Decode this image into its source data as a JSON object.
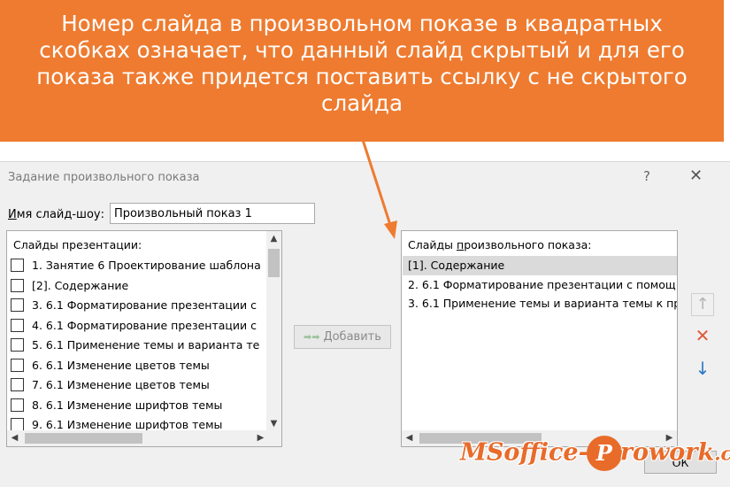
{
  "callout": {
    "text": "Номер слайда в произвольном показе в квадратных скобках означает, что данный слайд скрытый и для его показа также придется поставить ссылку с не скрытого слайда"
  },
  "dialog": {
    "title": "Задание произвольного показа",
    "help_label": "?",
    "close_label": "✕",
    "name_label_underlined": "И",
    "name_label_rest": "мя слайд-шоу:",
    "name_value": "Произвольный показ 1",
    "left_list": {
      "header": "Слайды презентации:",
      "items": [
        "1. Занятие 6 Проектирование шаблона",
        "[2]. Содержание",
        "3. 6.1 Форматирование презентации с",
        "4. 6.1 Форматирование презентации с",
        "5. 6.1 Применение темы и варианта те",
        "6. 6.1 Изменение цветов темы",
        "7. 6.1 Изменение цветов темы",
        "8. 6.1 Изменение шрифтов темы",
        "9. 6.1 Изменение шрифтов темы"
      ]
    },
    "add_button": {
      "icon": "double-arrow-right-icon",
      "label_underlined": "Д",
      "label_rest": "обавить"
    },
    "right_list": {
      "header_start": "Слайды ",
      "header_underlined": "п",
      "header_rest": "роизвольного показа:",
      "items": [
        "[1]. Содержание",
        "2. 6.1 Форматирование презентации с помощ",
        "3. 6.1 Применение темы и варианта темы к пр"
      ],
      "selected_index": 0
    },
    "side_buttons": {
      "up": "↑",
      "remove": "✕",
      "down": "↓"
    },
    "ok_label": "ОК"
  },
  "watermark": {
    "part1": "MSoffice-",
    "circle": "P",
    "part2": "rowork",
    "part3": ".com"
  },
  "colors": {
    "banner": "#ee7b30",
    "arrow": "#ee7b30",
    "remove_icon": "#e05a3c",
    "down_icon": "#2a79c6"
  }
}
